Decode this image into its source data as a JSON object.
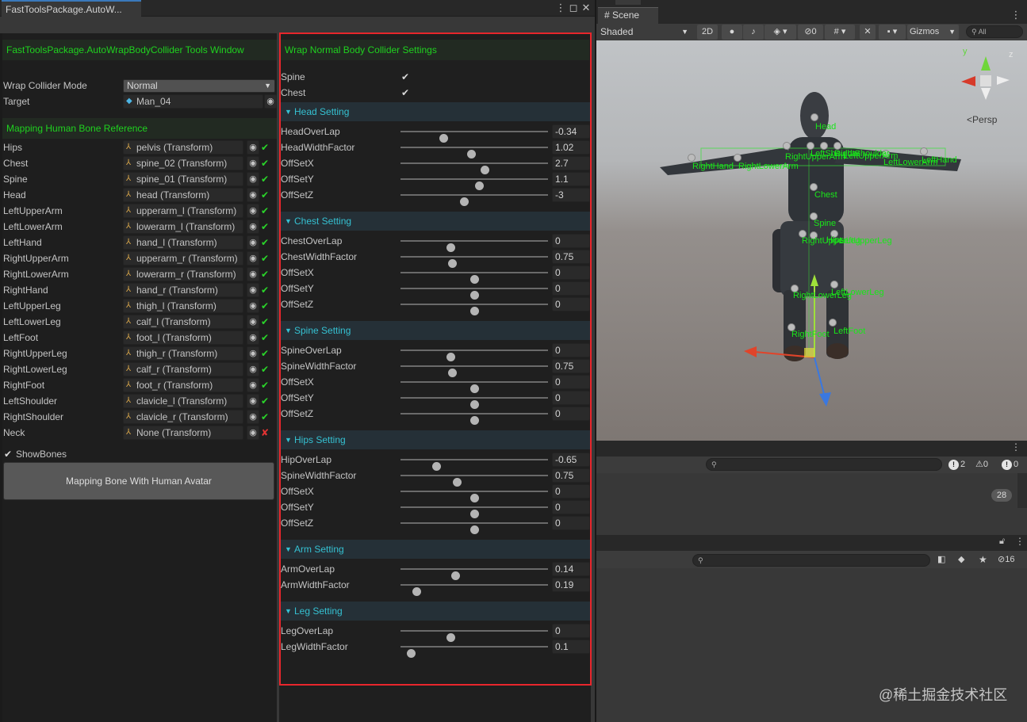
{
  "window_tab": "FastToolsPackage.AutoW...",
  "left_title": "FastToolsPackage.AutoWrapBodyCollider Tools Window",
  "wrap_mode": {
    "label": "Wrap Collider Mode",
    "value": "Normal"
  },
  "target": {
    "label": "Target",
    "value": "Man_04"
  },
  "mapping_title": "Mapping Human Bone Reference",
  "bones": [
    {
      "name": "Hips",
      "value": "pelvis (Transform)",
      "ok": true
    },
    {
      "name": "Chest",
      "value": "spine_02 (Transform)",
      "ok": true
    },
    {
      "name": "Spine",
      "value": "spine_01 (Transform)",
      "ok": true
    },
    {
      "name": "Head",
      "value": "head (Transform)",
      "ok": true
    },
    {
      "name": "LeftUpperArm",
      "value": "upperarm_l (Transform)",
      "ok": true
    },
    {
      "name": "LeftLowerArm",
      "value": "lowerarm_l (Transform)",
      "ok": true
    },
    {
      "name": "LeftHand",
      "value": "hand_l (Transform)",
      "ok": true
    },
    {
      "name": "RightUpperArm",
      "value": "upperarm_r (Transform)",
      "ok": true
    },
    {
      "name": "RightLowerArm",
      "value": "lowerarm_r (Transform)",
      "ok": true
    },
    {
      "name": "RightHand",
      "value": "hand_r (Transform)",
      "ok": true
    },
    {
      "name": "LeftUpperLeg",
      "value": "thigh_l (Transform)",
      "ok": true
    },
    {
      "name": "LeftLowerLeg",
      "value": "calf_l (Transform)",
      "ok": true
    },
    {
      "name": "LeftFoot",
      "value": "foot_l (Transform)",
      "ok": true
    },
    {
      "name": "RightUpperLeg",
      "value": "thigh_r (Transform)",
      "ok": true
    },
    {
      "name": "RightLowerLeg",
      "value": "calf_r (Transform)",
      "ok": true
    },
    {
      "name": "RightFoot",
      "value": "foot_r (Transform)",
      "ok": true
    },
    {
      "name": "LeftShoulder",
      "value": "clavicle_l (Transform)",
      "ok": true
    },
    {
      "name": "RightShoulder",
      "value": "clavicle_r (Transform)",
      "ok": true
    },
    {
      "name": "Neck",
      "value": "None (Transform)",
      "ok": false
    }
  ],
  "show_bones": {
    "label": "ShowBones",
    "checked": true
  },
  "map_button": "Mapping Bone With Human Avatar",
  "settings_title": "Wrap Normal Body Collider Settings",
  "toggles": [
    {
      "label": "Spine",
      "checked": true
    },
    {
      "label": "Chest",
      "checked": true
    }
  ],
  "sections": [
    {
      "title": "Head Setting",
      "rows": [
        {
          "label": "HeadOverLap",
          "value": "-0.34",
          "fill": 0.29
        },
        {
          "label": "HeadWidthFactor",
          "value": "1.02",
          "fill": 0.48
        },
        {
          "label": "OffSetX",
          "value": "2.7",
          "fill": 0.57
        },
        {
          "label": "OffSetY",
          "value": "1.1",
          "fill": 0.53
        },
        {
          "label": "OffSetZ",
          "value": "-3",
          "fill": 0.43
        }
      ]
    },
    {
      "title": "Chest Setting",
      "rows": [
        {
          "label": "ChestOverLap",
          "value": "0",
          "fill": 0.34
        },
        {
          "label": "ChestWidthFactor",
          "value": "0.75",
          "fill": 0.35
        },
        {
          "label": "OffSetX",
          "value": "0",
          "fill": 0.5
        },
        {
          "label": "OffSetY",
          "value": "0",
          "fill": 0.5
        },
        {
          "label": "OffSetZ",
          "value": "0",
          "fill": 0.5
        }
      ]
    },
    {
      "title": "Spine Setting",
      "rows": [
        {
          "label": "SpineOverLap",
          "value": "0",
          "fill": 0.34
        },
        {
          "label": "SpineWidthFactor",
          "value": "0.75",
          "fill": 0.35
        },
        {
          "label": "OffSetX",
          "value": "0",
          "fill": 0.5
        },
        {
          "label": "OffSetY",
          "value": "0",
          "fill": 0.5
        },
        {
          "label": "OffSetZ",
          "value": "0",
          "fill": 0.5
        }
      ]
    },
    {
      "title": "Hips Setting",
      "rows": [
        {
          "label": "HipOverLap",
          "value": "-0.65",
          "fill": 0.24
        },
        {
          "label": "SpineWidthFactor",
          "value": "0.75",
          "fill": 0.38
        },
        {
          "label": "OffSetX",
          "value": "0",
          "fill": 0.5
        },
        {
          "label": "OffSetY",
          "value": "0",
          "fill": 0.5
        },
        {
          "label": "OffSetZ",
          "value": "0",
          "fill": 0.5
        }
      ]
    },
    {
      "title": "Arm Setting",
      "rows": [
        {
          "label": "ArmOverLap",
          "value": "0.14",
          "fill": 0.37
        },
        {
          "label": "ArmWidthFactor",
          "value": "0.19",
          "fill": 0.11
        }
      ]
    },
    {
      "title": "Leg Setting",
      "rows": [
        {
          "label": "LegOverLap",
          "value": "0",
          "fill": 0.34
        },
        {
          "label": "LegWidthFactor",
          "value": "0.1",
          "fill": 0.07
        }
      ]
    }
  ],
  "scene": {
    "tab": "Scene",
    "shading": "Shaded",
    "mode_2d": "2D",
    "hidden_count": "0",
    "gizmos": "Gizmos",
    "search_placeholder": "All",
    "persp": "Persp",
    "labels": [
      "Head",
      "RightHand",
      "RightLowerArm",
      "RightUpperArm",
      "LeftUpperArm",
      "LeftLowerArm",
      "LeftHand",
      "Chest",
      "Spine",
      "Hips",
      "RightUpperLeg",
      "LeftUpperLeg",
      "RightLowerLeg",
      "LeftLowerLeg",
      "RightFoot",
      "LeftFoot",
      "LeftShoulder",
      "RightShoulder"
    ]
  },
  "console": {
    "logs": "2",
    "warnings": "0",
    "errors": "0",
    "collapsed_count": "28"
  },
  "project": {
    "hidden_count": "16"
  },
  "watermark": "@稀土掘金技术社区",
  "colors": {
    "accent_green": "#1fd21f",
    "teal": "#35c1d2",
    "highlight_red": "#e8262c",
    "ok": "#2ad52a",
    "error": "#e23333"
  }
}
